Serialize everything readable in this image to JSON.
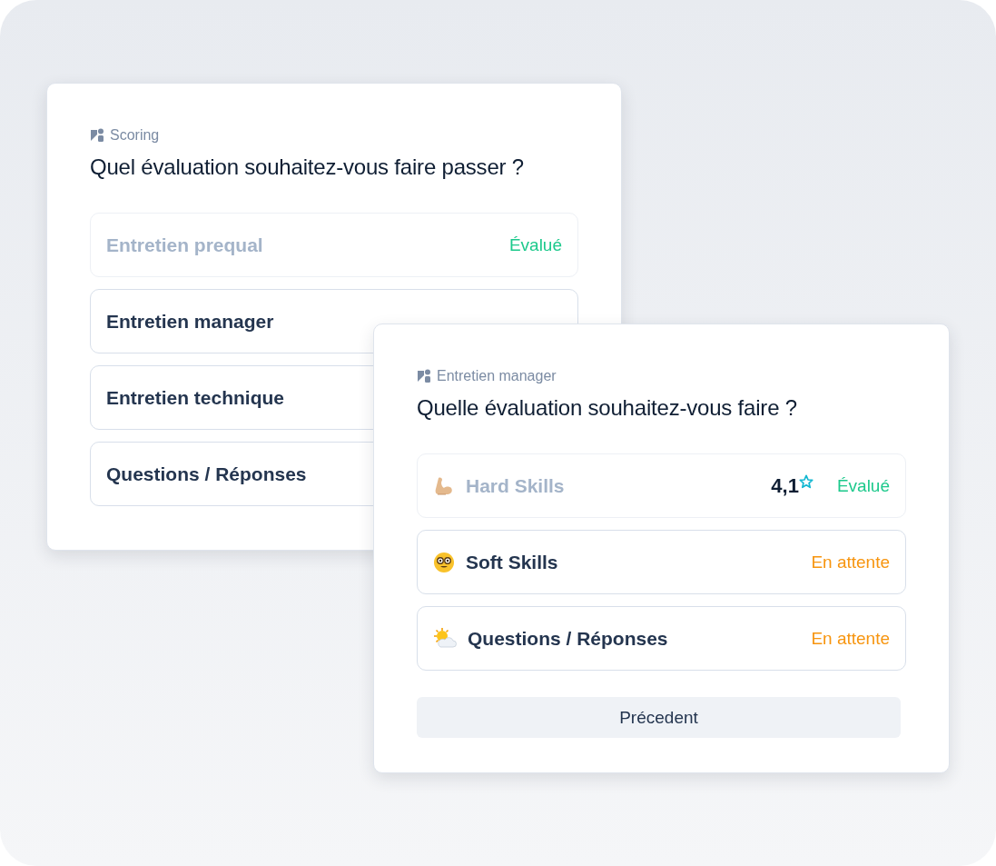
{
  "back_card": {
    "eyebrow": "Scoring",
    "title": "Quel évaluation souhaitez-vous faire passer ?",
    "items": [
      {
        "label": "Entretien prequal",
        "evaluated": true,
        "status": "Évalué"
      },
      {
        "label": "Entretien manager",
        "evaluated": false
      },
      {
        "label": "Entretien technique",
        "evaluated": false
      },
      {
        "label": "Questions / Réponses",
        "evaluated": false
      }
    ]
  },
  "front_card": {
    "eyebrow": "Entretien manager",
    "title": "Quelle évaluation souhaitez-vous faire ?",
    "items": [
      {
        "label": "Hard Skills",
        "kind": "arm",
        "evaluated": true,
        "score": "4,1",
        "status": "Évalué"
      },
      {
        "label": "Soft Skills",
        "kind": "nerd",
        "evaluated": false,
        "status": "En attente"
      },
      {
        "label": "Questions / Réponses",
        "kind": "sun",
        "evaluated": false,
        "status": "En attente"
      }
    ],
    "button": "Précedent"
  }
}
